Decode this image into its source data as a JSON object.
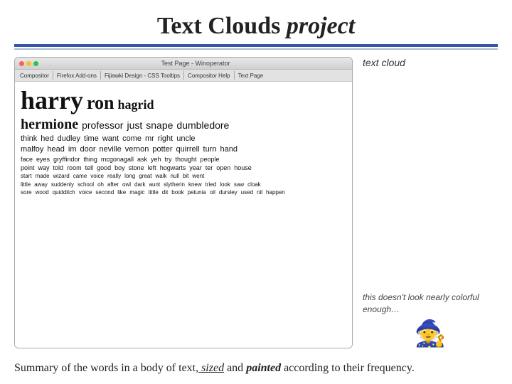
{
  "page": {
    "title_normal": "Text Clouds",
    "title_italic": " project"
  },
  "browser": {
    "window_title": "Test Page - Winoperator",
    "toolbar_items": [
      "Compositor",
      "Firefox Add-ons",
      "Fijiawki Design - CSS Tooltips",
      "Compositor Help",
      "Text Page"
    ]
  },
  "text_cloud": {
    "label": "text cloud",
    "rows": [
      [
        {
          "text": "harry",
          "size": "huge"
        },
        {
          "text": "ron",
          "size": "xlarge"
        },
        {
          "text": "hagrid",
          "size": "large2"
        }
      ],
      [
        {
          "text": "hermione",
          "size": "large"
        },
        {
          "text": "professor",
          "size": "medium"
        },
        {
          "text": "just",
          "size": "medium"
        },
        {
          "text": "snape",
          "size": "medium"
        },
        {
          "text": "dumbledore",
          "size": "medium"
        }
      ],
      [
        {
          "text": "think",
          "size": "small"
        },
        {
          "text": "hed",
          "size": "small"
        },
        {
          "text": "dudley",
          "size": "small"
        },
        {
          "text": "time",
          "size": "small"
        },
        {
          "text": "want",
          "size": "small"
        },
        {
          "text": "come",
          "size": "small"
        },
        {
          "text": "mr",
          "size": "small"
        },
        {
          "text": "right",
          "size": "small"
        },
        {
          "text": "uncle",
          "size": "small"
        }
      ],
      [
        {
          "text": "malfoy",
          "size": "small"
        },
        {
          "text": "head",
          "size": "small"
        },
        {
          "text": "im",
          "size": "small"
        },
        {
          "text": "door",
          "size": "small"
        },
        {
          "text": "neville",
          "size": "small"
        },
        {
          "text": "vernon",
          "size": "small"
        },
        {
          "text": "potter",
          "size": "small"
        },
        {
          "text": "quirrell",
          "size": "small"
        },
        {
          "text": "turn",
          "size": "small"
        },
        {
          "text": "hand",
          "size": "small"
        }
      ],
      [
        {
          "text": "face",
          "size": "tiny"
        },
        {
          "text": "eyes",
          "size": "tiny"
        },
        {
          "text": "gryffindor",
          "size": "tiny"
        },
        {
          "text": "thing",
          "size": "tiny"
        },
        {
          "text": "mcgonagall",
          "size": "tiny"
        },
        {
          "text": "ask",
          "size": "tiny"
        },
        {
          "text": "yeh",
          "size": "tiny"
        },
        {
          "text": "try",
          "size": "tiny"
        },
        {
          "text": "thought",
          "size": "tiny"
        },
        {
          "text": "people",
          "size": "tiny"
        }
      ],
      [
        {
          "text": "point",
          "size": "tiny"
        },
        {
          "text": "way",
          "size": "tiny"
        },
        {
          "text": "told",
          "size": "tiny"
        },
        {
          "text": "room",
          "size": "tiny"
        },
        {
          "text": "tell",
          "size": "tiny"
        },
        {
          "text": "good",
          "size": "tiny"
        },
        {
          "text": "boy",
          "size": "tiny"
        },
        {
          "text": "stone",
          "size": "tiny"
        },
        {
          "text": "left",
          "size": "tiny"
        },
        {
          "text": "hogwarts",
          "size": "tiny"
        },
        {
          "text": "year",
          "size": "tiny"
        },
        {
          "text": "ter",
          "size": "tiny"
        },
        {
          "text": "open",
          "size": "tiny"
        },
        {
          "text": "house",
          "size": "tiny"
        }
      ],
      [
        {
          "text": "start",
          "size": "micro"
        },
        {
          "text": "made",
          "size": "micro"
        },
        {
          "text": "wizard",
          "size": "micro"
        },
        {
          "text": "came",
          "size": "micro"
        },
        {
          "text": "voice",
          "size": "micro"
        },
        {
          "text": "really",
          "size": "micro"
        },
        {
          "text": "long",
          "size": "micro"
        },
        {
          "text": "great",
          "size": "micro"
        },
        {
          "text": "walk",
          "size": "micro"
        },
        {
          "text": "null",
          "size": "micro"
        },
        {
          "text": "bit",
          "size": "micro"
        },
        {
          "text": "went",
          "size": "micro"
        }
      ],
      [
        {
          "text": "little",
          "size": "micro"
        },
        {
          "text": "away",
          "size": "micro"
        },
        {
          "text": "suddenly",
          "size": "micro"
        },
        {
          "text": "school",
          "size": "micro"
        },
        {
          "text": "oh",
          "size": "micro"
        },
        {
          "text": "after",
          "size": "micro"
        },
        {
          "text": "owl",
          "size": "micro"
        },
        {
          "text": "dark",
          "size": "micro"
        },
        {
          "text": "aunt",
          "size": "micro"
        },
        {
          "text": "slytherin",
          "size": "micro"
        },
        {
          "text": "knew",
          "size": "micro"
        },
        {
          "text": "tried",
          "size": "micro"
        },
        {
          "text": "look",
          "size": "micro"
        },
        {
          "text": "saw",
          "size": "micro"
        },
        {
          "text": "cloak",
          "size": "micro"
        }
      ],
      [
        {
          "text": "sore",
          "size": "micro"
        },
        {
          "text": "wood",
          "size": "micro"
        },
        {
          "text": "quidditch",
          "size": "micro"
        },
        {
          "text": "voice",
          "size": "micro"
        },
        {
          "text": "second",
          "size": "micro"
        },
        {
          "text": "like",
          "size": "micro"
        },
        {
          "text": "magic",
          "size": "micro"
        },
        {
          "text": "little",
          "size": "micro"
        },
        {
          "text": "dit",
          "size": "micro"
        },
        {
          "text": "book",
          "size": "micro"
        },
        {
          "text": "petunia",
          "size": "micro"
        },
        {
          "text": "oil",
          "size": "micro"
        },
        {
          "text": "dursley",
          "size": "micro"
        },
        {
          "text": "used",
          "size": "micro"
        },
        {
          "text": "nil",
          "size": "micro"
        },
        {
          "text": "happen",
          "size": "micro"
        }
      ]
    ]
  },
  "annotation": {
    "text": "this doesn't look nearly colorful enough…",
    "emoji": "🧙"
  },
  "summary": {
    "text_before_sized": "Summary of the words in a body of text,",
    "sized_word": " sized",
    "text_between": " and",
    "painted_word": " painted",
    "text_after": " according to their frequency."
  }
}
